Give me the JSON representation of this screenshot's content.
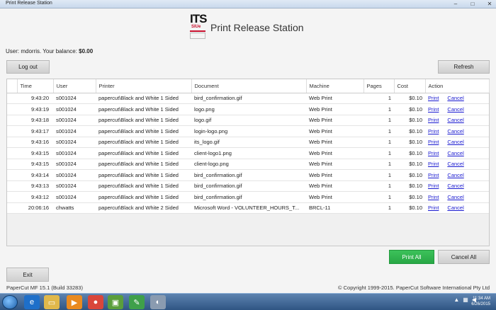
{
  "window": {
    "title": "Print Release Station"
  },
  "logo": {
    "its": "ITS",
    "siue": "SIUe"
  },
  "header": {
    "title": "Print Release Station"
  },
  "account": {
    "user_label": "User: mdorris. Your balance:",
    "balance": "$0.00"
  },
  "buttons": {
    "logout": "Log out",
    "refresh": "Refresh",
    "print_all": "Print All",
    "cancel_all": "Cancel All",
    "exit": "Exit"
  },
  "table": {
    "columns": [
      "Time",
      "User",
      "Printer",
      "Document",
      "Machine",
      "Pages",
      "Cost",
      "Action"
    ],
    "action_print": "Print",
    "action_cancel": "Cancel",
    "rows": [
      {
        "time": "9:43:20",
        "user": "s001024",
        "printer": "papercut\\Black and White 1 Sided",
        "document": "bird_confirmation.gif",
        "machine": "Web Print",
        "pages": "1",
        "cost": "$0.10"
      },
      {
        "time": "9:43:19",
        "user": "s001024",
        "printer": "papercut\\Black and White 1 Sided",
        "document": "logo.png",
        "machine": "Web Print",
        "pages": "1",
        "cost": "$0.10"
      },
      {
        "time": "9:43:18",
        "user": "s001024",
        "printer": "papercut\\Black and White 1 Sided",
        "document": "logo.gif",
        "machine": "Web Print",
        "pages": "1",
        "cost": "$0.10"
      },
      {
        "time": "9:43:17",
        "user": "s001024",
        "printer": "papercut\\Black and White 1 Sided",
        "document": "login-logo.png",
        "machine": "Web Print",
        "pages": "1",
        "cost": "$0.10"
      },
      {
        "time": "9:43:16",
        "user": "s001024",
        "printer": "papercut\\Black and White 1 Sided",
        "document": "its_logo.gif",
        "machine": "Web Print",
        "pages": "1",
        "cost": "$0.10"
      },
      {
        "time": "9:43:15",
        "user": "s001024",
        "printer": "papercut\\Black and White 1 Sided",
        "document": "client-logo1.png",
        "machine": "Web Print",
        "pages": "1",
        "cost": "$0.10"
      },
      {
        "time": "9:43:15",
        "user": "s001024",
        "printer": "papercut\\Black and White 1 Sided",
        "document": "client-logo.png",
        "machine": "Web Print",
        "pages": "1",
        "cost": "$0.10"
      },
      {
        "time": "9:43:14",
        "user": "s001024",
        "printer": "papercut\\Black and White 1 Sided",
        "document": "bird_confirmation.gif",
        "machine": "Web Print",
        "pages": "1",
        "cost": "$0.10"
      },
      {
        "time": "9:43:13",
        "user": "s001024",
        "printer": "papercut\\Black and White 1 Sided",
        "document": "bird_confirmation.gif",
        "machine": "Web Print",
        "pages": "1",
        "cost": "$0.10"
      },
      {
        "time": "9:43:12",
        "user": "s001024",
        "printer": "papercut\\Black and White 1 Sided",
        "document": "bird_confirmation.gif",
        "machine": "Web Print",
        "pages": "1",
        "cost": "$0.10"
      },
      {
        "time": "20:06:16",
        "user": "chwatts",
        "printer": "papercut\\Black and White 2 Sided",
        "document": "Microsoft Word - VOLUNTEER_HOURS_T...",
        "machine": "BRCL-11",
        "pages": "1",
        "cost": "$0.10"
      }
    ]
  },
  "footer": {
    "version": "PaperCut MF  15.1 (Build 33283)",
    "copyright": "© Copyright 1999-2015. PaperCut Software International Pty Ltd"
  },
  "taskbar": {
    "time": "11:34 AM",
    "date": "6/26/2015"
  },
  "colors": {
    "print_all": "#28a745",
    "link": "#1a1ad0",
    "siue_red": "#c8102e"
  }
}
